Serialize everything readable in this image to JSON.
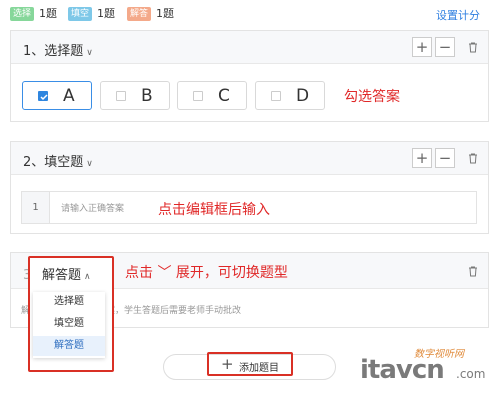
{
  "summary": {
    "items": [
      {
        "tag": "选择",
        "count": "1题",
        "color": "#86d79a"
      },
      {
        "tag": "填空",
        "count": "1题",
        "color": "#7ec8e8"
      },
      {
        "tag": "解答",
        "count": "1题",
        "color": "#f4a98a"
      }
    ],
    "settings_link": "设置计分"
  },
  "questions": [
    {
      "title": "1、选择题",
      "options": [
        "A",
        "B",
        "C",
        "D"
      ],
      "selected": "A",
      "annotation": "勾选答案"
    },
    {
      "title": "2、填空题",
      "row_number": "1",
      "input_placeholder": "请输入正确答案",
      "annotation": "点击编辑框后输入"
    },
    {
      "title_number": "3、",
      "title_label": "解答题",
      "hint_left": "解",
      "hint_right": "答案，学生答题后需要老师手动批改",
      "annotation": "点击 ﹀ 展开，可切换题型",
      "type_menu": [
        "选择题",
        "填空题",
        "解答题"
      ],
      "type_menu_active": "解答题"
    }
  ],
  "add_button": {
    "icon": "+",
    "label": "添加题目"
  },
  "icons": {
    "plus": "+",
    "minus": "−",
    "chevron": "chevron-down-icon",
    "trash": "trash-icon"
  },
  "accent": "#2f86df",
  "annotation_color": "#e02828",
  "watermark": {
    "main": "itavcn",
    "sub": ".com",
    "cn": "数字视听网"
  }
}
